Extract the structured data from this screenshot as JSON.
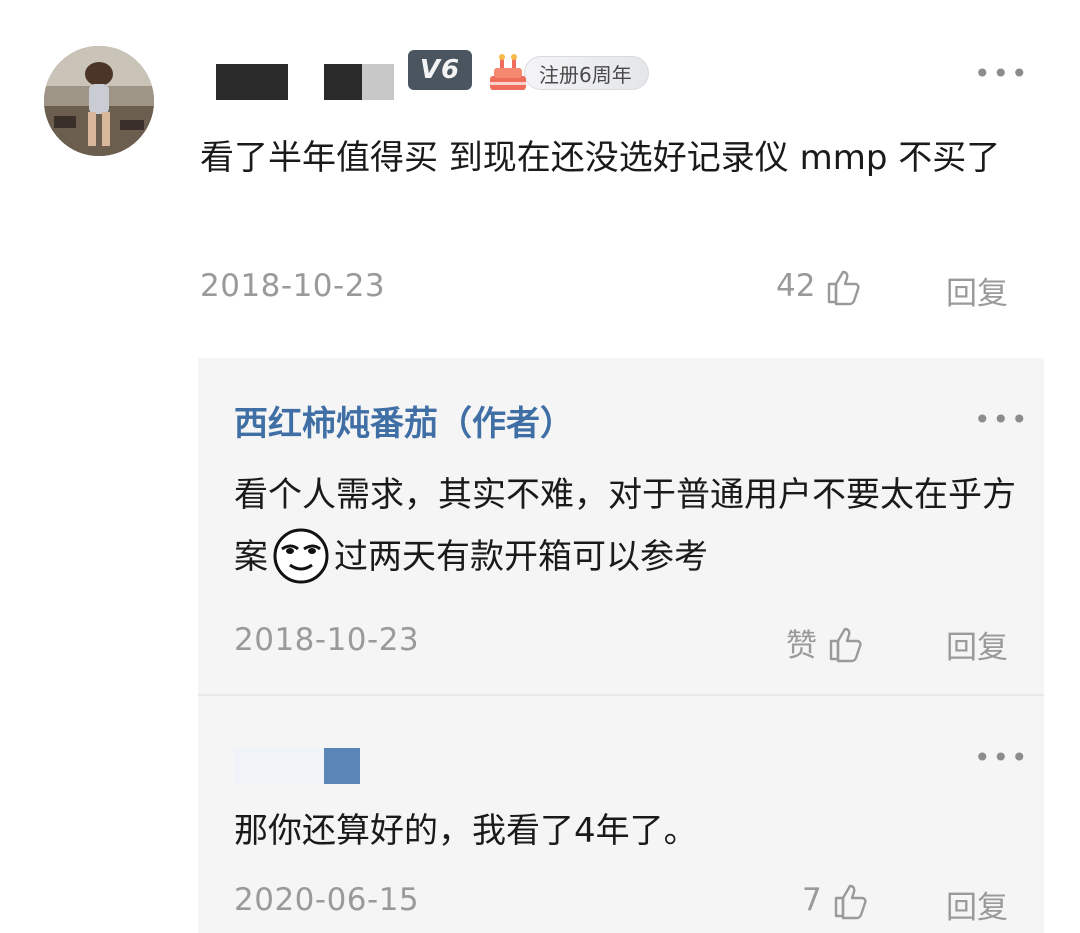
{
  "comment": {
    "level_badge": "V6",
    "anniversary_badge": "注册6周年",
    "more_label": "•••",
    "text": "看了半年值得买 到现在还没选好记录仪 mmp 不买了",
    "date": "2018-10-23",
    "likes": "42",
    "reply_label": "回复",
    "icons": {
      "like": "thumbs-up-icon",
      "more": "more-dots-icon"
    }
  },
  "replies": [
    {
      "author": "西红柿炖番茄（作者）",
      "text_before": "看个人需求，其实不难，对于普通用户不要太在乎方案",
      "emoji": "smirk-face-emoji",
      "text_after": "过两天有款开箱可以参考",
      "date": "2018-10-23",
      "likes": "赞",
      "reply_label": "回复",
      "more_label": "•••"
    },
    {
      "author": "",
      "text": "那你还算好的，我看了4年了。",
      "date": "2020-06-15",
      "likes": "7",
      "reply_label": "回复",
      "more_label": "•••"
    }
  ],
  "colors": {
    "author_blue": "#3f6fa5",
    "meta_gray": "#9a9a9a",
    "reply_bg": "#f5f5f5"
  }
}
